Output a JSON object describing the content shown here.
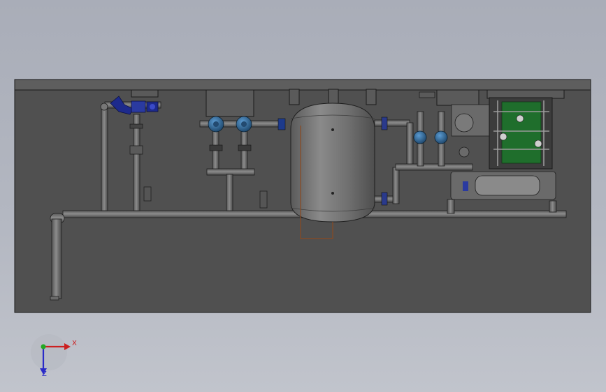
{
  "view": {
    "background_top": "#a9adb8",
    "background_bottom": "#c1c4cc"
  },
  "model": {
    "panel_color": "#505050",
    "edge_color": "#1a1a1a",
    "pipe_color": "#6c6c6c",
    "tank_color": "#727272",
    "valve_blue": "#2a5f8c",
    "valve_navy": "#1d2a8c",
    "module_green": "#1f6e2c",
    "wire_orange": "#8a4a22"
  },
  "triad": {
    "x_label": "X",
    "y_label": "Z",
    "x_color": "#cc2020",
    "y_color": "#2a2ac8",
    "origin_color": "#22aa22"
  }
}
